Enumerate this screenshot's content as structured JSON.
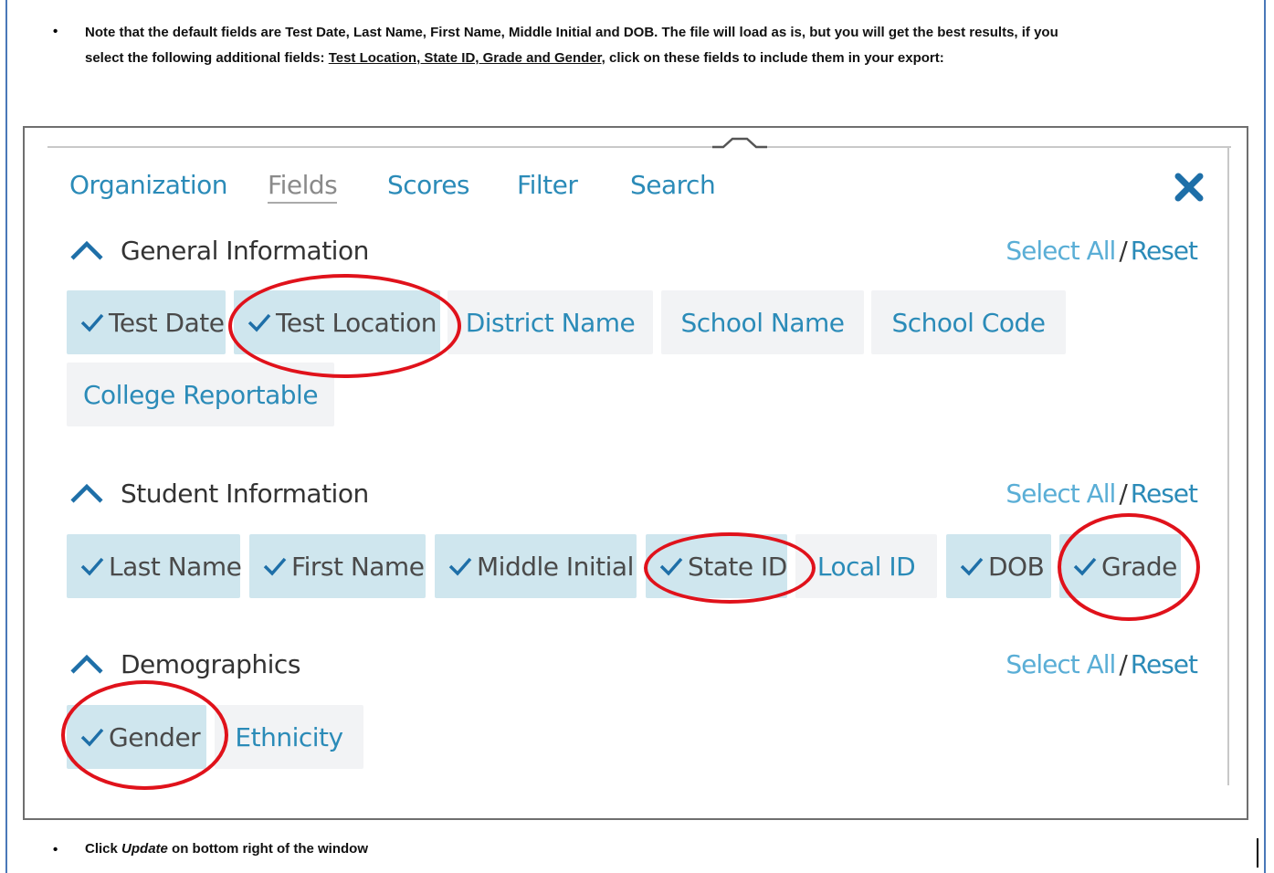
{
  "instructions": {
    "note_line1": "Note that the default fields are Test Date, Last Name, First Name, Middle Initial and DOB.  The file will load as is, but you will get the best results, if you",
    "note_line2_pre": "select the following additional fields: ",
    "note_line2_underlined": "Test Location, State ID, Grade and Gender,",
    "note_line2_post": " click on these fields to include them in your export:",
    "click_pre": "Click ",
    "click_bold": "Update",
    "click_post": " on bottom right of the window",
    "bullet": "•"
  },
  "tabs": [
    "Organization",
    "Fields",
    "Scores",
    "Filter",
    "Search"
  ],
  "active_tab": "Fields",
  "select_all": "Select All",
  "separator": "/",
  "reset": "Reset",
  "sections": {
    "general": {
      "title": "General Information",
      "fields": [
        {
          "label": "Test Date",
          "checked": true
        },
        {
          "label": "Test Location",
          "checked": true
        },
        {
          "label": "District Name",
          "checked": false
        },
        {
          "label": "School Name",
          "checked": false
        },
        {
          "label": "School Code",
          "checked": false
        },
        {
          "label": "College Reportable",
          "checked": false
        }
      ]
    },
    "student": {
      "title": "Student Information",
      "fields": [
        {
          "label": "Last Name",
          "checked": true
        },
        {
          "label": "First Name",
          "checked": true
        },
        {
          "label": "Middle Initial",
          "checked": true
        },
        {
          "label": "State ID",
          "checked": true
        },
        {
          "label": "Local ID",
          "checked": false
        },
        {
          "label": "DOB",
          "checked": true
        },
        {
          "label": "Grade",
          "checked": true
        }
      ]
    },
    "demographics": {
      "title": "Demographics",
      "fields": [
        {
          "label": "Gender",
          "checked": true
        },
        {
          "label": "Ethnicity",
          "checked": false
        }
      ]
    }
  },
  "colors": {
    "accent": "#2b8bb8",
    "chip_selected": "#cfe6ee",
    "chip_unselected": "#f2f3f5",
    "highlight": "#e0121b",
    "close": "#1e6fa8"
  }
}
